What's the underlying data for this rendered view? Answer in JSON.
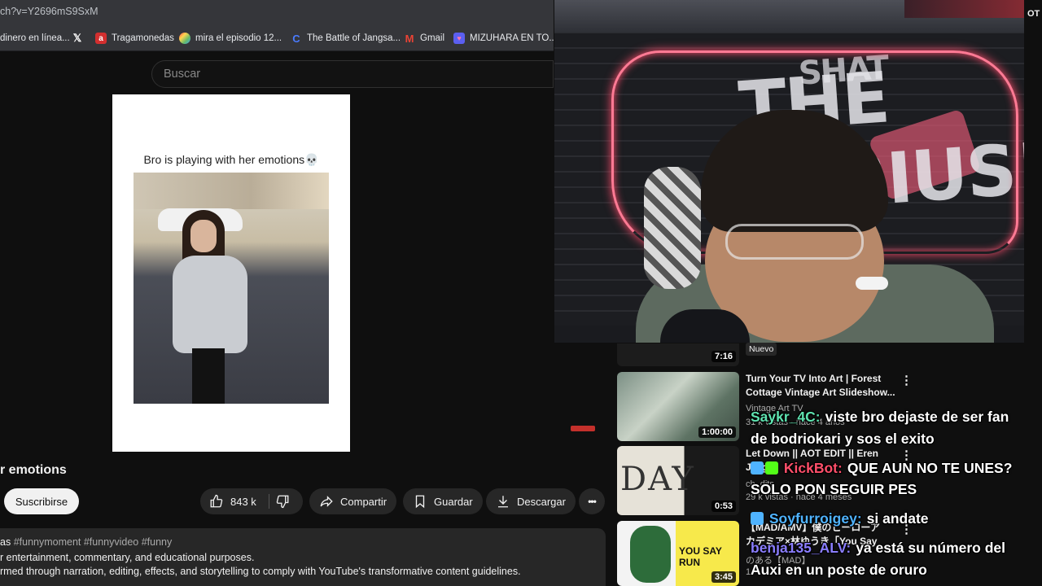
{
  "browser": {
    "url_fragment": "ch?v=Y2696mS9SxM",
    "bookmarks": [
      {
        "label": "dinero en línea...",
        "icon": "none"
      },
      {
        "label": "",
        "icon": "x-logo-icon"
      },
      {
        "label": "Tragamonedas",
        "icon": "a-logo-icon"
      },
      {
        "label": "mira el episodio 12...",
        "icon": "colorful-logo-icon"
      },
      {
        "label": "The Battle of Jangsa...",
        "icon": "c-logo-icon"
      },
      {
        "label": "Gmail",
        "icon": "gmail-icon"
      },
      {
        "label": "MIZUHARA EN TO...",
        "icon": "heart-shield-icon"
      }
    ]
  },
  "search": {
    "placeholder": "Buscar"
  },
  "short": {
    "caption": "Bro is playing with her emotions💀"
  },
  "video": {
    "title_fragment": "r emotions",
    "subscribe_label": "Suscribirse",
    "likes": "843 k",
    "share_label": "Compartir",
    "save_label": "Guardar",
    "download_label": "Descargar",
    "more_label": "•••"
  },
  "description": {
    "line1_prefix": "as",
    "line1_tags": "#funnymoment #funnyvideo #funny",
    "line2": "r entertainment, commentary, and educational purposes.",
    "line3": "rmed through narration, editing, effects, and storytelling to comply with YouTube's transformative content guidelines."
  },
  "top_right_text": "OT",
  "webcam": {
    "logo_text": "THE FABIUS!",
    "logo_small": "SHAT"
  },
  "recommendations": [
    {
      "duration": "7:16",
      "badge": "Nuevo"
    },
    {
      "title1": "Turn Your TV Into Art | Forest",
      "title2": "Cottage Vintage Art Slideshow...",
      "channel": "Vintage Art TV",
      "meta": "31 k vistas · hace 4 años",
      "duration": "1:00:00"
    },
    {
      "title1": "Let Down || AOT EDIT || Eren",
      "title2": "Jaeger",
      "channel": "ch_dits",
      "meta": "29 k vistas · hace 4 meses",
      "duration": "0:53",
      "thumb_text": "DAY"
    },
    {
      "title1": "【MAD/AMV】僕のヒーローア",
      "title2": "カデミア×林ゆうき「You Say",
      "channel": "のある【MAD】",
      "meta": "1",
      "duration": "3:45",
      "thumb_text": "YOU SAY RUN"
    }
  ],
  "chat": [
    {
      "user": "Saykr_4C:",
      "user_color": "#5fe3b0",
      "text": "viste bro dejaste de ser fan",
      "badges": []
    },
    {
      "user": "",
      "user_color": "#ffffff",
      "text": "de bodriokari y sos el exito",
      "badges": []
    },
    {
      "user": "KickBot:",
      "user_color": "#ff4f6a",
      "text": "QUE AUN NO TE UNES?",
      "badges": [
        "sword",
        "verified"
      ]
    },
    {
      "user": "",
      "user_color": "#ffffff",
      "text": "SOLO PON SEGUIR PES",
      "badges": []
    },
    {
      "user": "Soyfurroigey:",
      "user_color": "#4fb3ff",
      "text": "si andate",
      "badges": [
        "sword"
      ]
    },
    {
      "user": "benja135_ALV:",
      "user_color": "#8a7dff",
      "text": "ya está su número del",
      "badges": []
    },
    {
      "user": "",
      "user_color": "#ffffff",
      "text": "Auxi en un poste de oruro",
      "badges": []
    }
  ]
}
